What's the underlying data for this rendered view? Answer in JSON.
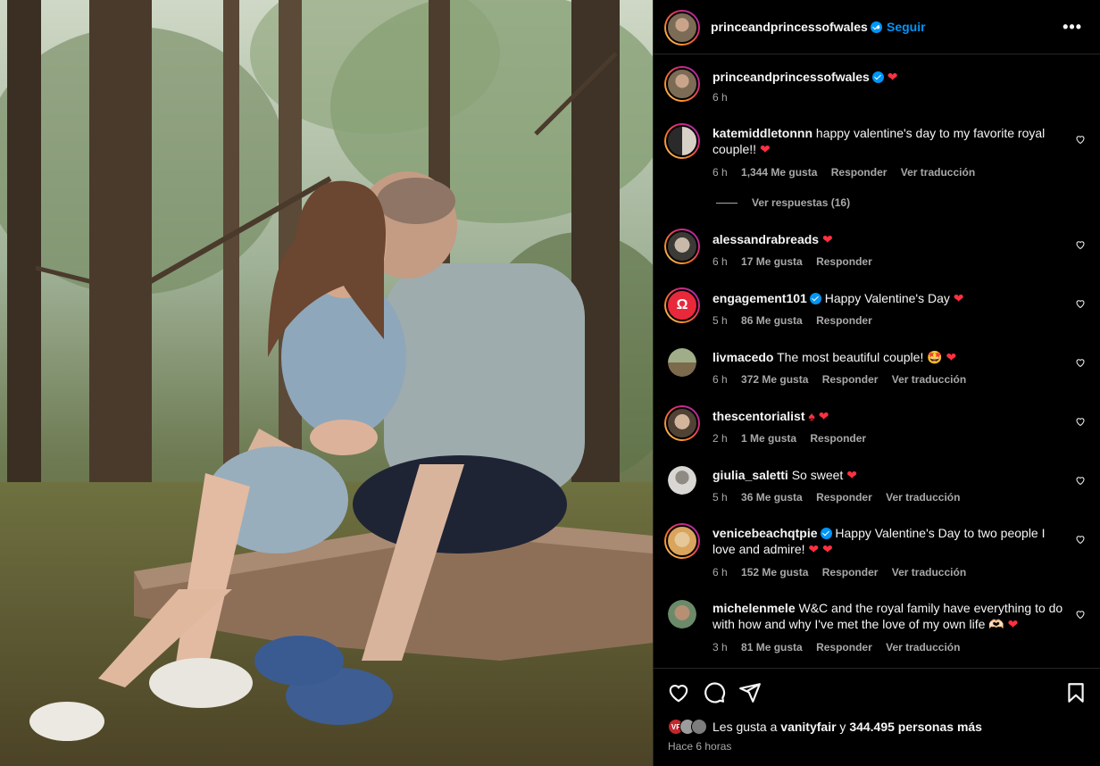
{
  "post": {
    "author": "princeandprincessofwales",
    "follow_label": "Seguir",
    "separator": "•",
    "more_label": "•••",
    "caption_time": "6 h",
    "caption_heart": "❤"
  },
  "comments": [
    {
      "user": "katemiddletonnn",
      "text": "happy valentine's day to my favorite royal couple!!",
      "emoji": "❤",
      "time": "6 h",
      "likes": "1,344 Me gusta",
      "reply": "Responder",
      "translate": "Ver traducción"
    },
    {
      "user": "alessandrabreads",
      "text": "",
      "emoji": "❤",
      "time": "6 h",
      "likes": "17 Me gusta",
      "reply": "Responder",
      "translate": ""
    },
    {
      "user": "engagement101",
      "text": "Happy Valentine's Day",
      "emoji": "❤",
      "time": "5 h",
      "likes": "86 Me gusta",
      "reply": "Responder",
      "translate": ""
    },
    {
      "user": "livmacedo",
      "text": "The most beautiful couple!",
      "emoji": "🤩 ❤",
      "time": "6 h",
      "likes": "372 Me gusta",
      "reply": "Responder",
      "translate": "Ver traducción"
    },
    {
      "user": "thescentorialist",
      "text": "",
      "emoji": "♠ ❤",
      "time": "2 h",
      "likes": "1 Me gusta",
      "reply": "Responder",
      "translate": ""
    },
    {
      "user": "giulia_saletti",
      "text": "So sweet",
      "emoji": "❤",
      "time": "5 h",
      "likes": "36 Me gusta",
      "reply": "Responder",
      "translate": "Ver traducción"
    },
    {
      "user": "venicebeachqtpie",
      "text": "Happy Valentine's Day to two people I love and admire!",
      "emoji": "❤ ❤",
      "time": "6 h",
      "likes": "152 Me gusta",
      "reply": "Responder",
      "translate": "Ver traducción"
    },
    {
      "user": "michelenmele",
      "text": "W&C and the royal family have everything to do with how and why I've met the love of my own life 🫶🏻",
      "emoji": "❤",
      "time": "3 h",
      "likes": "81 Me gusta",
      "reply": "Responder",
      "translate": "Ver traducción"
    }
  ],
  "replies_label": "Ver respuestas (16)",
  "footer": {
    "likes_prefix": "Les gusta a ",
    "likes_user": "vanityfair",
    "likes_mid": " y ",
    "likes_count": "344.495 personas más",
    "time_ago": "Hace 6 horas"
  },
  "icons": [
    "heart-icon",
    "comment-icon",
    "share-icon",
    "bookmark-icon",
    "verified-badge-icon",
    "like-comment-icon"
  ],
  "colors": {
    "accent": "#0095f6",
    "heart": "#ff3040",
    "muted": "#a8a8a8",
    "background": "#000000"
  }
}
